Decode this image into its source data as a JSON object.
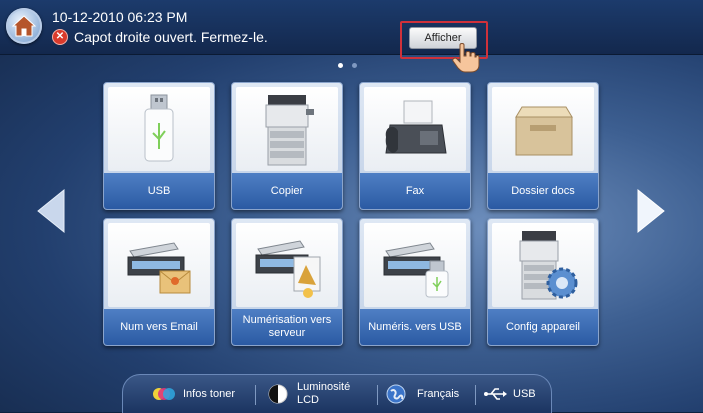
{
  "status_bar": {
    "datetime": "10-12-2010 06:23 PM",
    "alert_message": "Capot droite ouvert. Fermez-le.",
    "show_button_label": "Afficher"
  },
  "pager": {
    "pages": 2,
    "current_page": 1
  },
  "apps": [
    {
      "label": "USB",
      "icon": "usb-drive-icon"
    },
    {
      "label": "Copier",
      "icon": "copier-icon"
    },
    {
      "label": "Fax",
      "icon": "fax-icon"
    },
    {
      "label": "Dossier docs",
      "icon": "folder-box-icon"
    },
    {
      "label": "Num vers Email",
      "icon": "scan-to-email-icon"
    },
    {
      "label": "Numérisation vers serveur",
      "icon": "scan-to-server-icon"
    },
    {
      "label": "Numéris. vers USB",
      "icon": "scan-to-usb-icon"
    },
    {
      "label": "Config appareil",
      "icon": "device-settings-icon"
    }
  ],
  "bottom_bar": {
    "toner_label": "Infos toner",
    "brightness_label": "Luminosité LCD",
    "language_label": "Français",
    "usb_label": "USB"
  },
  "colors": {
    "tile_label_bg": "#3a6ab5",
    "alert_red": "#d93a2c",
    "frame_red": "#d0313a"
  }
}
